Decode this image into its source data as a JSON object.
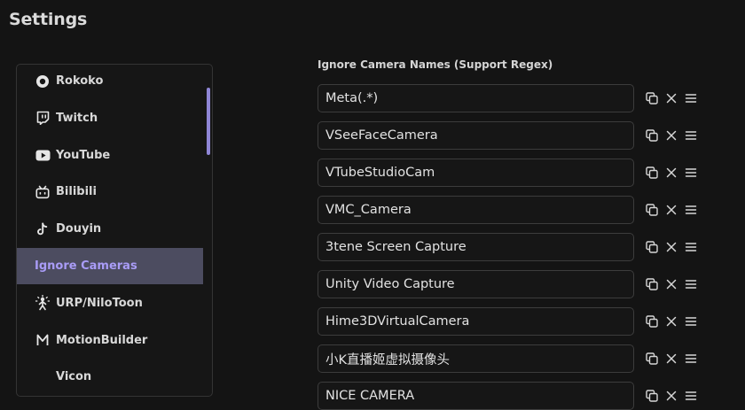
{
  "page": {
    "title": "Settings"
  },
  "sidebar": {
    "items": [
      {
        "id": "rokoko",
        "label": "Rokoko",
        "icon": "rokoko-icon",
        "active": false
      },
      {
        "id": "twitch",
        "label": "Twitch",
        "icon": "twitch-icon",
        "active": false
      },
      {
        "id": "youtube",
        "label": "YouTube",
        "icon": "youtube-icon",
        "active": false
      },
      {
        "id": "bilibili",
        "label": "Bilibili",
        "icon": "bilibili-icon",
        "active": false
      },
      {
        "id": "douyin",
        "label": "Douyin",
        "icon": "douyin-icon",
        "active": false
      },
      {
        "id": "ignore-cameras",
        "label": "Ignore Cameras",
        "icon": "",
        "active": true
      },
      {
        "id": "urp-nilotoon",
        "label": "URP/NiloToon",
        "icon": "nilotoon-icon",
        "active": false
      },
      {
        "id": "motionbuilder",
        "label": "MotionBuilder",
        "icon": "motionbuilder-icon",
        "active": false
      },
      {
        "id": "vicon",
        "label": "Vicon",
        "icon": "",
        "active": false
      }
    ]
  },
  "main": {
    "section_label": "Ignore Camera Names (Support Regex)",
    "entries": [
      "Meta(.*)",
      "VSeeFaceCamera",
      "VTubeStudioCam",
      "VMC_Camera",
      "3tene Screen Capture",
      "Unity Video Capture",
      "Hime3DVirtualCamera",
      "小K直播姬虚拟摄像头",
      "NICE CAMERA"
    ],
    "row_actions": [
      "copy-icon",
      "close-icon",
      "drag-handle-icon"
    ]
  },
  "colors": {
    "background": "#141414",
    "accent": "#a99cf7",
    "active_bg": "#4c4c60",
    "scrollbar": "#8f86d6",
    "border": "#3c3c3c"
  }
}
